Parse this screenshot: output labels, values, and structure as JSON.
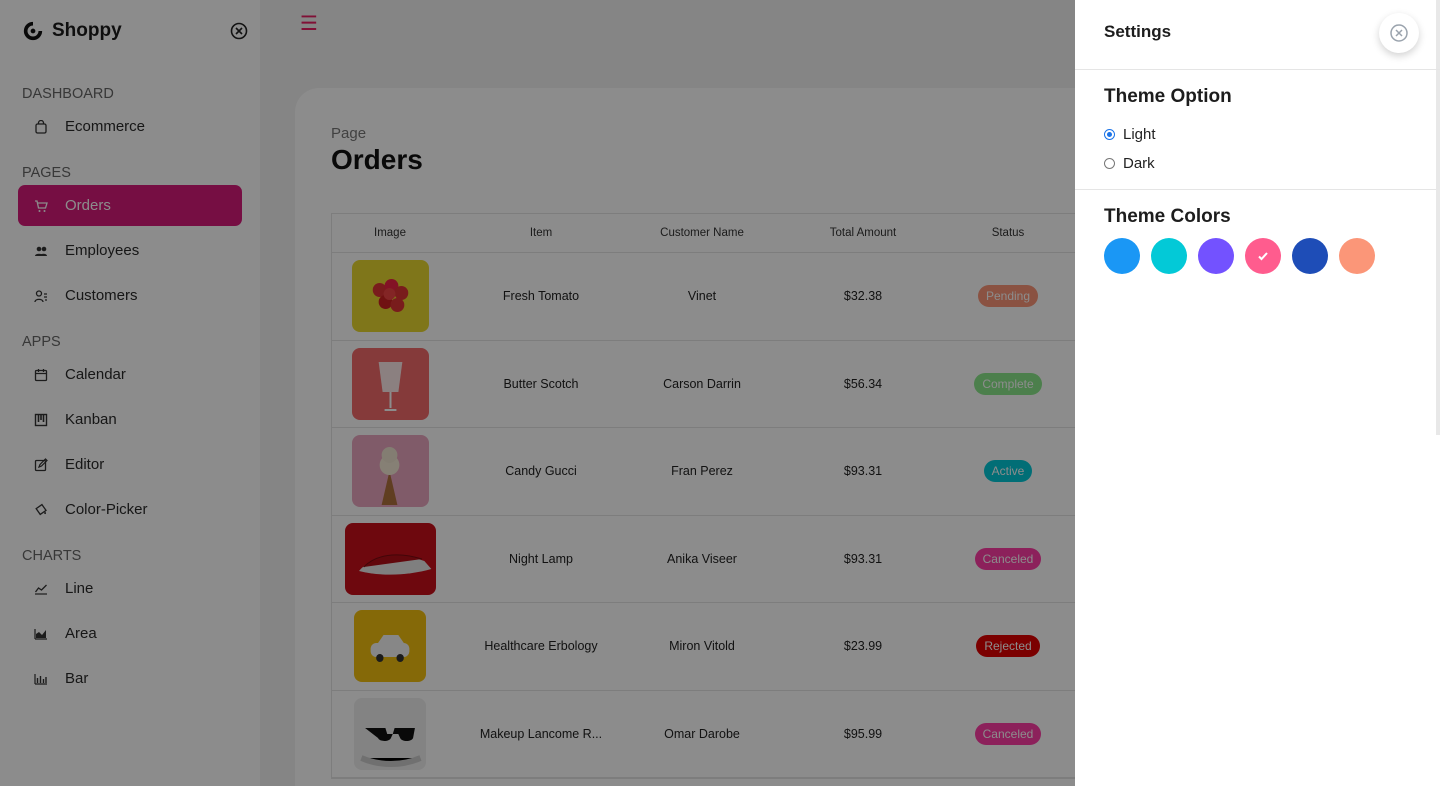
{
  "brand": {
    "name": "Shoppy"
  },
  "sidebar": {
    "sections": [
      {
        "title": "DASHBOARD",
        "items": [
          {
            "label": "Ecommerce",
            "icon": "bag-icon"
          }
        ]
      },
      {
        "title": "PAGES",
        "items": [
          {
            "label": "Orders",
            "icon": "cart-icon",
            "active": true
          },
          {
            "label": "Employees",
            "icon": "employees-icon"
          },
          {
            "label": "Customers",
            "icon": "customers-icon"
          }
        ]
      },
      {
        "title": "APPS",
        "items": [
          {
            "label": "Calendar",
            "icon": "calendar-icon"
          },
          {
            "label": "Kanban",
            "icon": "kanban-icon"
          },
          {
            "label": "Editor",
            "icon": "editor-icon"
          },
          {
            "label": "Color-Picker",
            "icon": "color-picker-icon"
          }
        ]
      },
      {
        "title": "CHARTS",
        "items": [
          {
            "label": "Line",
            "icon": "line-chart-icon"
          },
          {
            "label": "Area",
            "icon": "area-chart-icon"
          },
          {
            "label": "Bar",
            "icon": "bar-chart-icon"
          }
        ]
      }
    ]
  },
  "page": {
    "sub": "Page",
    "title": "Orders"
  },
  "table": {
    "headers": {
      "image": "Image",
      "item": "Item",
      "customer": "Customer Name",
      "amount": "Total Amount",
      "status": "Status"
    },
    "rows": [
      {
        "item": "Fresh Tomato",
        "customer": "Vinet",
        "amount": "$32.38",
        "status": "Pending",
        "status_color": "#fb9678",
        "thumb_bg": "#e8d830"
      },
      {
        "item": "Butter Scotch",
        "customer": "Carson Darrin",
        "amount": "$56.34",
        "status": "Complete",
        "status_color": "#8be78b",
        "thumb_bg": "#f26a6a"
      },
      {
        "item": "Candy Gucci",
        "customer": "Fran Perez",
        "amount": "$93.31",
        "status": "Active",
        "status_color": "#03c9d7",
        "thumb_bg": "#e9a7c0"
      },
      {
        "item": "Night Lamp",
        "customer": "Anika Viseer",
        "amount": "$93.31",
        "status": "Canceled",
        "status_color": "#ff3da6",
        "thumb_bg": "#c8101a"
      },
      {
        "item": "Healthcare Erbology",
        "customer": "Miron Vitold",
        "amount": "$23.99",
        "status": "Rejected",
        "status_color": "#e00000",
        "thumb_bg": "#f2c00f"
      },
      {
        "item": "Makeup Lancome R...",
        "customer": "Omar Darobe",
        "amount": "$95.99",
        "status": "Canceled",
        "status_color": "#ff3da6",
        "thumb_bg": "#eeeeee"
      }
    ]
  },
  "settings": {
    "title": "Settings",
    "theme_option_title": "Theme Option",
    "options": [
      {
        "label": "Light",
        "checked": true
      },
      {
        "label": "Dark",
        "checked": false
      }
    ],
    "theme_colors_title": "Theme Colors",
    "colors": [
      "#1a97f5",
      "#03c9d7",
      "#7352ff",
      "#ff5c8e",
      "#1e4db7",
      "#fb9678"
    ],
    "selected_color_index": 3
  }
}
